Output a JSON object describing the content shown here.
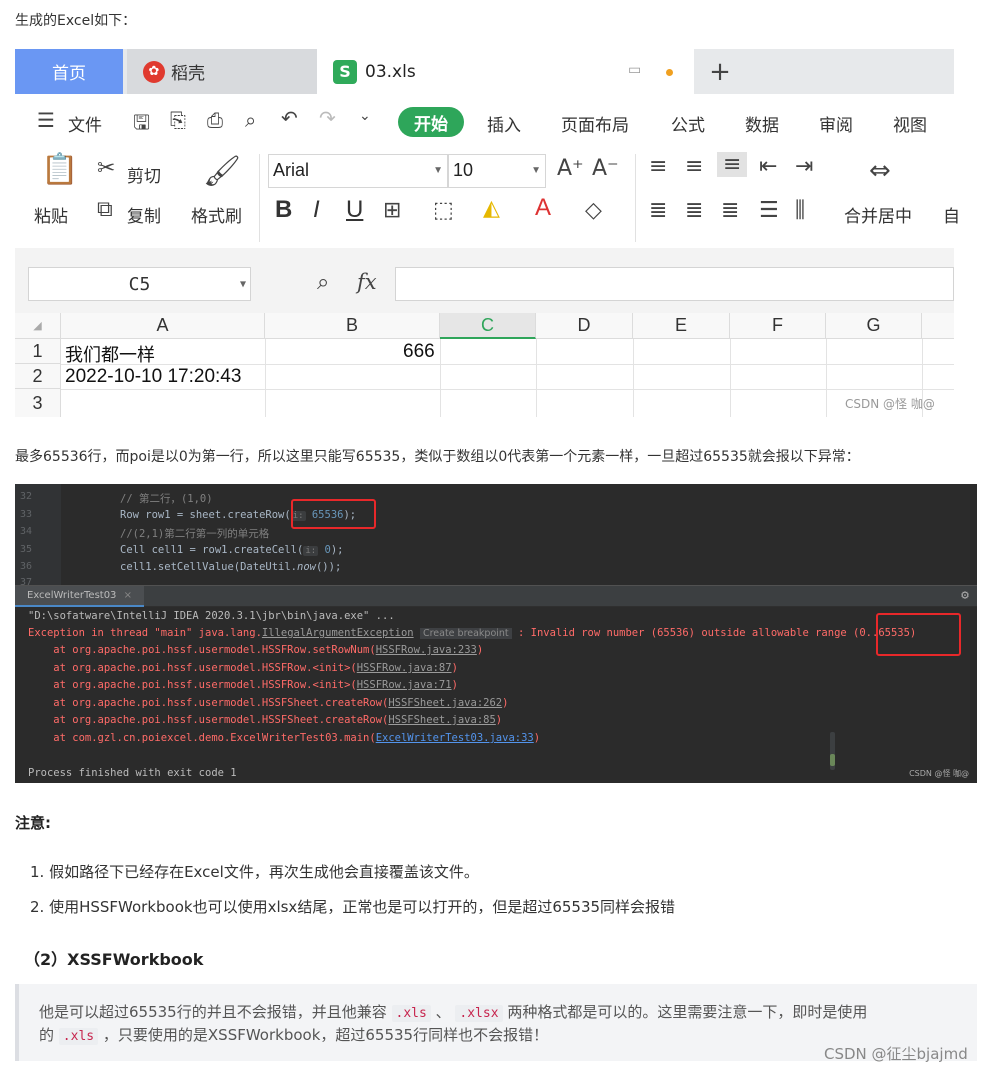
{
  "intro_text": "生成的Excel如下：",
  "excel": {
    "tabs": {
      "home": "首页",
      "docer": "稻壳",
      "file": "03.xls",
      "plus": "+"
    },
    "docer_icon": "docer-logo-icon",
    "sheet_icon_letter": "S",
    "menu": {
      "file": "文件",
      "start": "开始",
      "insert": "插入",
      "page_layout": "页面布局",
      "formula": "公式",
      "data": "数据",
      "review": "审阅",
      "view": "视图"
    },
    "ribbon": {
      "paste": "粘贴",
      "cut": "剪切",
      "copy": "复制",
      "format_painter": "格式刷",
      "font_name": "Arial",
      "font_size": "10",
      "merge": "合并居中",
      "truncated": "自"
    },
    "name_box": "C5",
    "fx": "fx",
    "columns": [
      "A",
      "B",
      "C",
      "D",
      "E",
      "F",
      "G"
    ],
    "rows": [
      "1",
      "2",
      "3"
    ],
    "cells": {
      "a1": "我们都一样",
      "b1": "666",
      "a2": "2022-10-10 17:20:43"
    },
    "watermark": "CSDN @怪 咖@",
    "accent_color": "#2ea65a"
  },
  "paragraph1": "最多65536行，而poi是以0为第一行，所以这里只能写65535，类似于数组以0代表第一个元素一样，一旦超过65535就会报以下异常：",
  "ide": {
    "line_numbers": [
      "32",
      "33",
      "34",
      "35",
      "36",
      "37"
    ],
    "code": {
      "l32": "// 第二行，(1,0)",
      "l33_pre": "Row row1 = sheet.createRow(",
      "l33_hint": "i:",
      "l33_num": "65536",
      "l33_post": ");",
      "l34": "//(2,1)第二行第一列的单元格",
      "l35_pre": "Cell cell1 = row1.createCell(",
      "l35_hint": "i:",
      "l35_num": "0",
      "l35_post": ");",
      "l36_pre": "cell1.setCellValue(DateUtil.",
      "l36_italic": "now",
      "l36_post": "());"
    },
    "run_tab": "ExcelWriterTest03",
    "run_tab_close": "×",
    "console": {
      "cmd": "\"D:\\sofatware\\IntelliJ IDEA 2020.3.1\\jbr\\bin\\java.exe\" ...",
      "ex_pre": "Exception in thread \"main\" java.lang.",
      "ex_class": "IllegalArgumentException",
      "ex_bp": "Create breakpoint",
      "ex_post": " : Invalid row number (65536) outside allowable range (0..65535)",
      "frames": [
        {
          "pre": "    at org.apache.poi.hssf.usermodel.HSSFRow.setRowNum(",
          "link": "HSSFRow.java:233",
          "post": ")"
        },
        {
          "pre": "    at org.apache.poi.hssf.usermodel.HSSFRow.<init>(",
          "link": "HSSFRow.java:87",
          "post": ")"
        },
        {
          "pre": "    at org.apache.poi.hssf.usermodel.HSSFRow.<init>(",
          "link": "HSSFRow.java:71",
          "post": ")"
        },
        {
          "pre": "    at org.apache.poi.hssf.usermodel.HSSFSheet.createRow(",
          "link": "HSSFSheet.java:262",
          "post": ")"
        },
        {
          "pre": "    at org.apache.poi.hssf.usermodel.HSSFSheet.createRow(",
          "link": "HSSFSheet.java:85",
          "post": ")"
        },
        {
          "pre": "    at com.gzl.cn.poiexcel.demo.ExcelWriterTest03.main(",
          "link": "ExcelWriterTest03.java:33",
          "post": ")"
        }
      ],
      "exit": "Process finished with exit code 1"
    },
    "watermark": "CSDN @怪 咖@",
    "highlight_color": "#e8282a"
  },
  "note_title": "注意:",
  "list": [
    "1. 假如路径下已经存在Excel文件，再次生成他会直接覆盖该文件。",
    "2. 使用HSSFWorkbook也可以使用xlsx结尾，正常也是可以打开的，但是超过65535同样会报错"
  ],
  "heading": "（2）XSSFWorkbook",
  "quote": {
    "l1_a": "他是可以超过65535行的并且不会报错，并且他兼容",
    "code1": ".xls",
    "l1_b": "、",
    "code2": ".xlsx",
    "l1_c": "两种格式都是可以的。这里需要注意一下，即时是使用",
    "l2_a": "的",
    "code3": ".xls",
    "l2_b": "，只要使用的是XSSFWorkbook，超过65535行同样也不会报错！"
  },
  "page_watermark": "CSDN @征尘bjajmd"
}
